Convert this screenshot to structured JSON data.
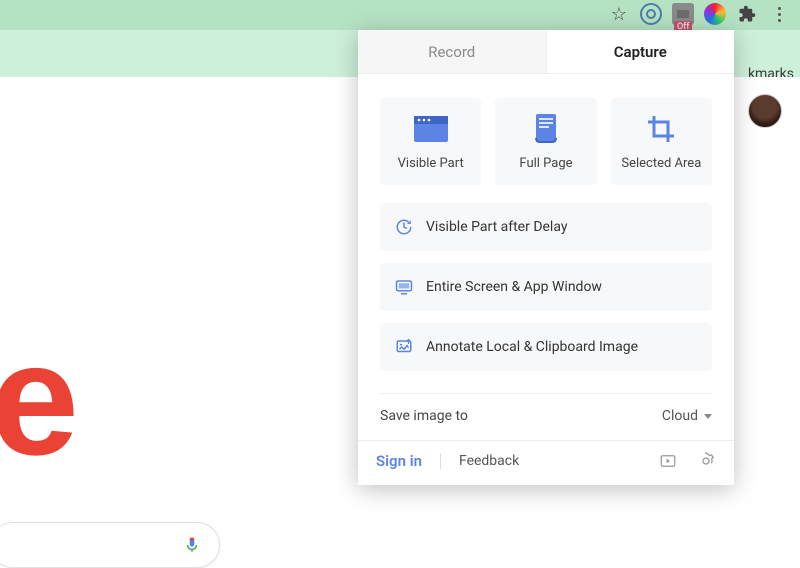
{
  "browser": {
    "bookmarks_hint": "kmarks",
    "ext_badge": "Off"
  },
  "popup": {
    "tabs": {
      "record": "Record",
      "capture": "Capture"
    },
    "tiles": {
      "visible_part": "Visible Part",
      "full_page": "Full Page",
      "selected_area": "Selected Area"
    },
    "rows": {
      "delay": "Visible Part after Delay",
      "entire": "Entire Screen & App Window",
      "annotate": "Annotate Local & Clipboard Image"
    },
    "save": {
      "label": "Save image to",
      "value": "Cloud"
    },
    "footer": {
      "signin": "Sign in",
      "feedback": "Feedback"
    }
  }
}
